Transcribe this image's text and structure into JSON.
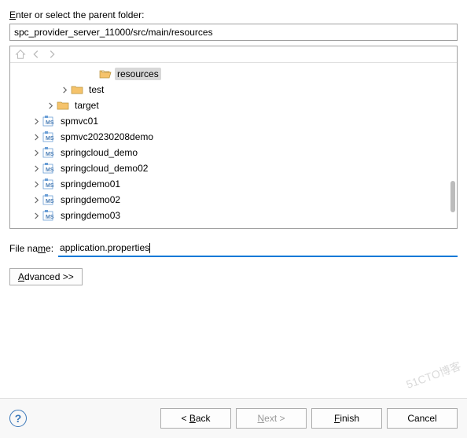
{
  "dialog": {
    "parent_label_pre": "E",
    "parent_label_post": "nter or select the parent folder:",
    "parent_value": "spc_provider_server_11000/src/main/resources",
    "filename_label_pre": "File na",
    "filename_label_u": "m",
    "filename_label_post": "e:",
    "filename_value": "application.properties",
    "advanced_label_pre": "A",
    "advanced_label_post": "dvanced >>"
  },
  "tree": {
    "items": [
      {
        "label": "resources",
        "indent": 4,
        "icon": "folder-open",
        "selected": true,
        "expandable": false
      },
      {
        "label": "test",
        "indent": 3,
        "icon": "folder",
        "expandable": true
      },
      {
        "label": "target",
        "indent": 2,
        "icon": "folder",
        "expandable": true
      },
      {
        "label": "spmvc01",
        "indent": 1,
        "icon": "project",
        "expandable": true
      },
      {
        "label": "spmvc20230208demo",
        "indent": 1,
        "icon": "project",
        "expandable": true
      },
      {
        "label": "springcloud_demo",
        "indent": 1,
        "icon": "project",
        "expandable": true
      },
      {
        "label": "springcloud_demo02",
        "indent": 1,
        "icon": "project",
        "expandable": true
      },
      {
        "label": "springdemo01",
        "indent": 1,
        "icon": "project",
        "expandable": true
      },
      {
        "label": "springdemo02",
        "indent": 1,
        "icon": "project",
        "expandable": true
      },
      {
        "label": "springdemo03",
        "indent": 1,
        "icon": "project",
        "expandable": true
      }
    ]
  },
  "footer": {
    "back": "< Back",
    "next": "Next >",
    "finish": "Finish",
    "cancel": "Cancel"
  },
  "watermark": "51CTO博客"
}
